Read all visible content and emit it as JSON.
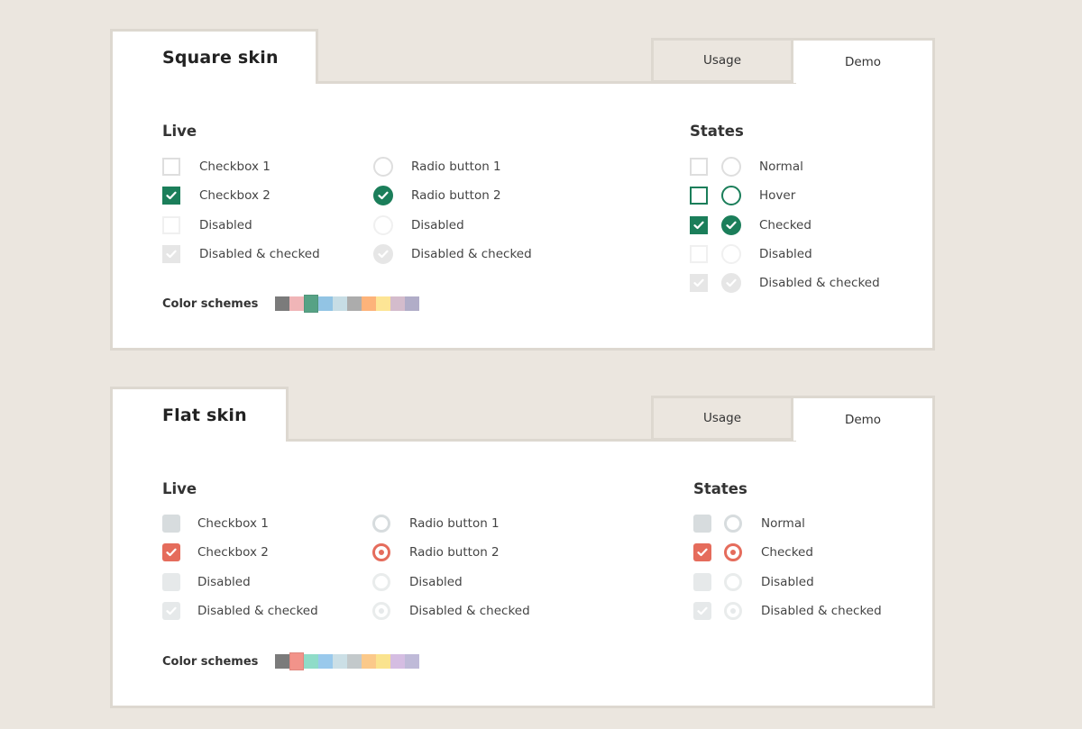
{
  "colors": {
    "page_bg": "#ebe6df",
    "square_accent": "#1b7e5a",
    "flat_accent": "#e56c5c"
  },
  "panels": [
    {
      "title": "Square skin",
      "tabs": [
        {
          "label": "Usage",
          "active": false
        },
        {
          "label": "Demo",
          "active": true
        }
      ],
      "live_heading": "Live",
      "states_heading": "States",
      "checkboxes": [
        {
          "label": "Checkbox 1",
          "state": "normal"
        },
        {
          "label": "Checkbox 2",
          "state": "checked"
        },
        {
          "label": "Disabled",
          "state": "disabled"
        },
        {
          "label": "Disabled & checked",
          "state": "disabled-checked"
        }
      ],
      "radios": [
        {
          "label": "Radio button 1",
          "state": "normal"
        },
        {
          "label": "Radio button 2",
          "state": "checked"
        },
        {
          "label": "Disabled",
          "state": "disabled"
        },
        {
          "label": "Disabled & checked",
          "state": "disabled-checked"
        }
      ],
      "states": [
        {
          "label": "Normal",
          "state": "normal"
        },
        {
          "label": "Hover",
          "state": "hover"
        },
        {
          "label": "Checked",
          "state": "checked"
        },
        {
          "label": "Disabled",
          "state": "disabled"
        },
        {
          "label": "Disabled & checked",
          "state": "disabled-checked"
        }
      ],
      "color_schemes_label": "Color schemes",
      "swatches": [
        "#7b7b7b",
        "#f0b5b7",
        "#57a285",
        "#92c4e4",
        "#c7dde5",
        "#acacac",
        "#fdb37a",
        "#fde595",
        "#d4bccc",
        "#b1adc8"
      ],
      "active_swatch": 2
    },
    {
      "title": "Flat skin",
      "tabs": [
        {
          "label": "Usage",
          "active": false
        },
        {
          "label": "Demo",
          "active": true
        }
      ],
      "live_heading": "Live",
      "states_heading": "States",
      "checkboxes": [
        {
          "label": "Checkbox 1",
          "state": "normal"
        },
        {
          "label": "Checkbox 2",
          "state": "checked"
        },
        {
          "label": "Disabled",
          "state": "disabled"
        },
        {
          "label": "Disabled & checked",
          "state": "disabled-checked"
        }
      ],
      "radios": [
        {
          "label": "Radio button 1",
          "state": "normal"
        },
        {
          "label": "Radio button 2",
          "state": "checked"
        },
        {
          "label": "Disabled",
          "state": "disabled"
        },
        {
          "label": "Disabled & checked",
          "state": "disabled-checked"
        }
      ],
      "states": [
        {
          "label": "Normal",
          "state": "normal"
        },
        {
          "label": "Checked",
          "state": "checked"
        },
        {
          "label": "Disabled",
          "state": "disabled"
        },
        {
          "label": "Disabled & checked",
          "state": "disabled-checked"
        }
      ],
      "color_schemes_label": "Color schemes",
      "swatches": [
        "#7b7b7b",
        "#f2938a",
        "#8fdcc8",
        "#99c9ec",
        "#cbdfe6",
        "#c3c9cb",
        "#fbc98a",
        "#fae38e",
        "#d5bde2",
        "#bfbad8"
      ],
      "active_swatch": 1
    }
  ]
}
